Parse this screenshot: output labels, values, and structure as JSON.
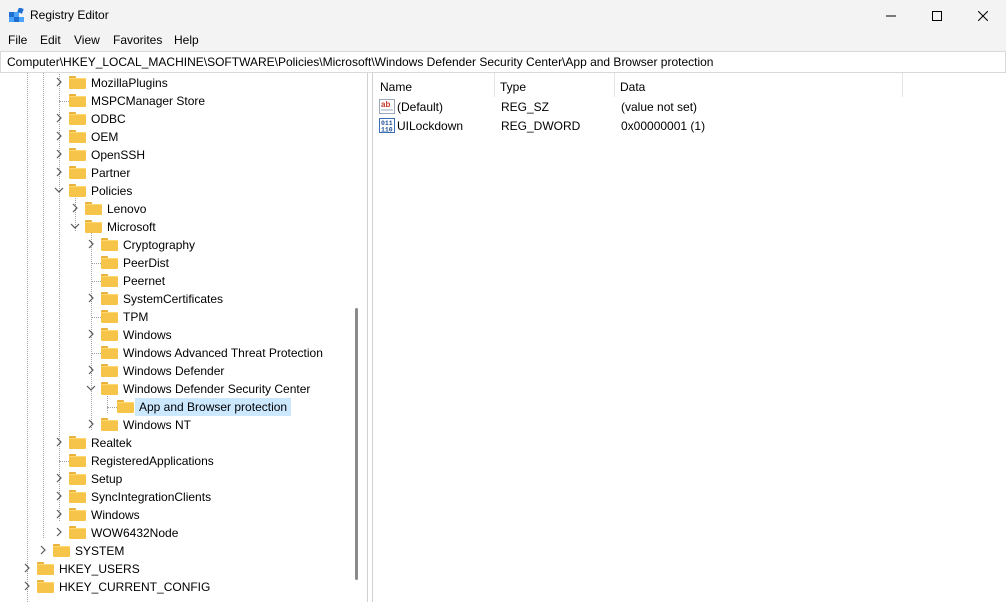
{
  "window": {
    "title": "Registry Editor",
    "icon": "registry-icon",
    "controls": [
      "minimize",
      "maximize",
      "close"
    ]
  },
  "menu": [
    "File",
    "Edit",
    "View",
    "Favorites",
    "Help"
  ],
  "address": "Computer\\HKEY_LOCAL_MACHINE\\SOFTWARE\\Policies\\Microsoft\\Windows Defender Security Center\\App and Browser protection",
  "tree": [
    {
      "label": "MozillaPlugins",
      "level": 2,
      "expand": "closed"
    },
    {
      "label": "MSPCManager Store",
      "level": 2,
      "expand": "none"
    },
    {
      "label": "ODBC",
      "level": 2,
      "expand": "closed"
    },
    {
      "label": "OEM",
      "level": 2,
      "expand": "closed"
    },
    {
      "label": "OpenSSH",
      "level": 2,
      "expand": "closed"
    },
    {
      "label": "Partner",
      "level": 2,
      "expand": "closed"
    },
    {
      "label": "Policies",
      "level": 2,
      "expand": "open"
    },
    {
      "label": "Lenovo",
      "level": 3,
      "expand": "closed"
    },
    {
      "label": "Microsoft",
      "level": 3,
      "expand": "open"
    },
    {
      "label": "Cryptography",
      "level": 4,
      "expand": "closed"
    },
    {
      "label": "PeerDist",
      "level": 4,
      "expand": "none"
    },
    {
      "label": "Peernet",
      "level": 4,
      "expand": "none"
    },
    {
      "label": "SystemCertificates",
      "level": 4,
      "expand": "closed"
    },
    {
      "label": "TPM",
      "level": 4,
      "expand": "none"
    },
    {
      "label": "Windows",
      "level": 4,
      "expand": "closed"
    },
    {
      "label": "Windows Advanced Threat Protection",
      "level": 4,
      "expand": "none"
    },
    {
      "label": "Windows Defender",
      "level": 4,
      "expand": "closed"
    },
    {
      "label": "Windows Defender Security Center",
      "level": 4,
      "expand": "open"
    },
    {
      "label": "App and Browser protection",
      "level": 5,
      "expand": "none",
      "selected": true
    },
    {
      "label": "Windows NT",
      "level": 4,
      "expand": "closed"
    },
    {
      "label": "Realtek",
      "level": 2,
      "expand": "closed"
    },
    {
      "label": "RegisteredApplications",
      "level": 2,
      "expand": "none"
    },
    {
      "label": "Setup",
      "level": 2,
      "expand": "closed"
    },
    {
      "label": "SyncIntegrationClients",
      "level": 2,
      "expand": "closed"
    },
    {
      "label": "Windows",
      "level": 2,
      "expand": "closed"
    },
    {
      "label": "WOW6432Node",
      "level": 2,
      "expand": "closed"
    },
    {
      "label": "SYSTEM",
      "level": 1,
      "expand": "closed"
    },
    {
      "label": "HKEY_USERS",
      "level": 0,
      "expand": "closed"
    },
    {
      "label": "HKEY_CURRENT_CONFIG",
      "level": 0,
      "expand": "closed"
    }
  ],
  "columns": [
    "Name",
    "Type",
    "Data"
  ],
  "values": [
    {
      "name": "(Default)",
      "type": "REG_SZ",
      "data": "(value not set)",
      "icon": "string-value-icon"
    },
    {
      "name": "UILockdown",
      "type": "REG_DWORD",
      "data": "0x00000001 (1)",
      "icon": "binary-value-icon"
    }
  ],
  "colors": {
    "selection": "#cce8ff",
    "folder": "#f7c44a",
    "chrome": "#f3f3f3"
  }
}
